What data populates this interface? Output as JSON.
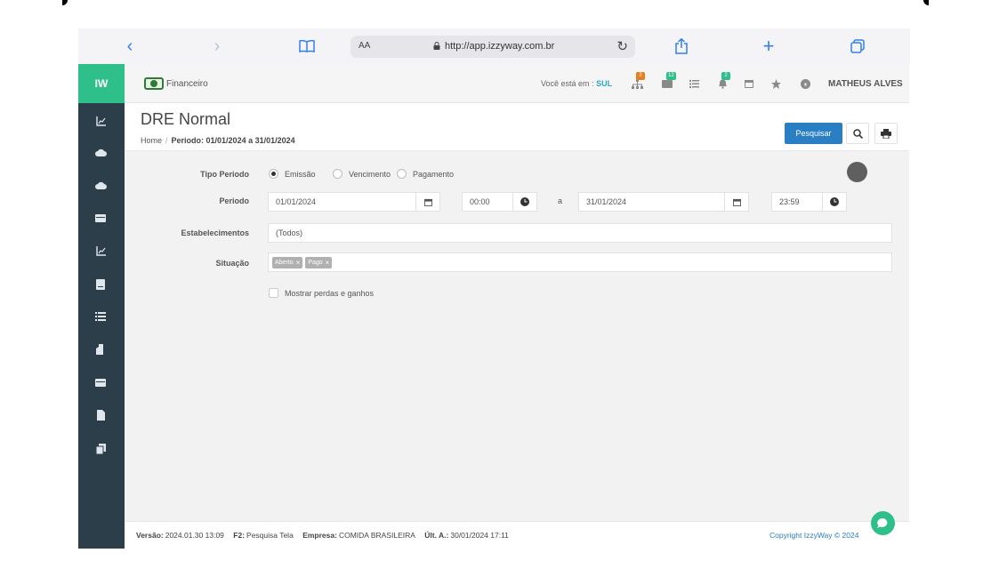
{
  "browser": {
    "aa": "AA",
    "url": "http://app.izzyway.com.br"
  },
  "sidebar": {
    "logo": "IW",
    "icons": [
      "chart-icon",
      "cloud-up-icon",
      "cloud-down-icon",
      "card-icon",
      "chart-icon",
      "book-icon",
      "list-icon",
      "building-icon",
      "card-icon",
      "file-icon",
      "copy-icon"
    ]
  },
  "topnav": {
    "module": "Financeiro",
    "you_are_label": "Você está em :",
    "location": "SUL",
    "badges": [
      "2",
      "12",
      "2"
    ],
    "username": "MATHEUS ALVES"
  },
  "header": {
    "title": "DRE Normal",
    "breadcrumb_home": "Home",
    "breadcrumb_sep": "/",
    "breadcrumb_current": "Periodo: 01/01/2024 a 31/01/2024",
    "search_button": "Pesquisar"
  },
  "form": {
    "tipo_periodo_label": "Tipo Periodo",
    "radio_emissao": "Emissão",
    "radio_vencimento": "Vencimento",
    "radio_pagamento": "Pagamento",
    "periodo_label": "Periodo",
    "date_from": "01/01/2024",
    "time_from": "00:00",
    "separator": "a",
    "date_to": "31/01/2024",
    "time_to": "23:59",
    "estabelecimentos_label": "Estabelecimentos",
    "estabelecimentos_value": "(Todos)",
    "situacao_label": "Situação",
    "tags": [
      "Aberto",
      "Pago"
    ],
    "checkbox_label": "Mostrar perdas e ganhos"
  },
  "footer": {
    "versao_label": "Versão:",
    "versao_value": "2024.01.30 13:09",
    "f2_label": "F2:",
    "f2_value": "Pesquisa Tela",
    "empresa_label": "Empresa:",
    "empresa_value": "COMIDA BRASILEIRA",
    "ult_label": "Últ. A.:",
    "ult_value": "30/01/2024 17:11",
    "copyright": "Copyright IzzyWay © 2024"
  },
  "colors": {
    "sidebar": "#2d3e4b",
    "accent_green": "#2fbf8b",
    "primary_blue": "#2a7ec4"
  }
}
